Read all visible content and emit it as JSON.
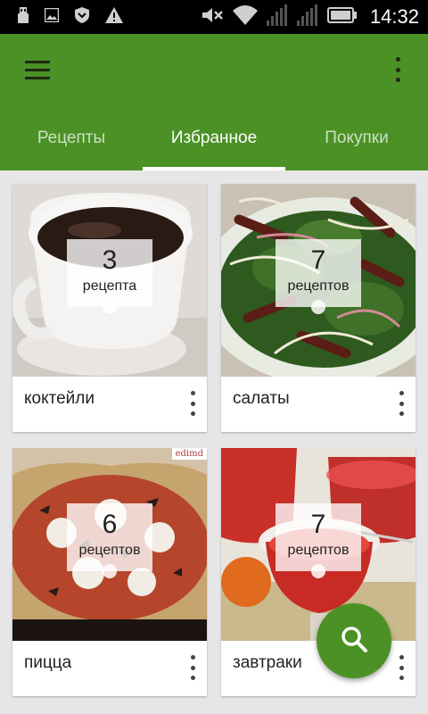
{
  "status_bar": {
    "time": "14:32",
    "icons": [
      "usb-icon",
      "image-icon",
      "shield-icon",
      "warning-icon",
      "mute-icon",
      "wifi-icon",
      "signal-icon",
      "signal-icon",
      "battery-icon"
    ]
  },
  "app_bar": {
    "menu_icon": "hamburger-menu-icon",
    "overflow_icon": "more-vert-icon",
    "background": "#4b9125"
  },
  "tabs": [
    {
      "label": "Рецепты",
      "active": false
    },
    {
      "label": "Избранное",
      "active": true
    },
    {
      "label": "Покупки",
      "active": false
    }
  ],
  "cards": [
    {
      "title": "коктейли",
      "count": "3",
      "count_word": "рецепта",
      "image": "cocoa-cup"
    },
    {
      "title": "салаты",
      "count": "7",
      "count_word": "рецептов",
      "image": "salad-plate"
    },
    {
      "title": "пицца",
      "count": "6",
      "count_word": "рецептов",
      "image": "pizza",
      "watermark": "edimd"
    },
    {
      "title": "завтраки",
      "count": "7",
      "count_word": "рецептов",
      "image": "red-dessert"
    }
  ],
  "fab": {
    "icon": "search-icon",
    "color": "#4b9125"
  }
}
